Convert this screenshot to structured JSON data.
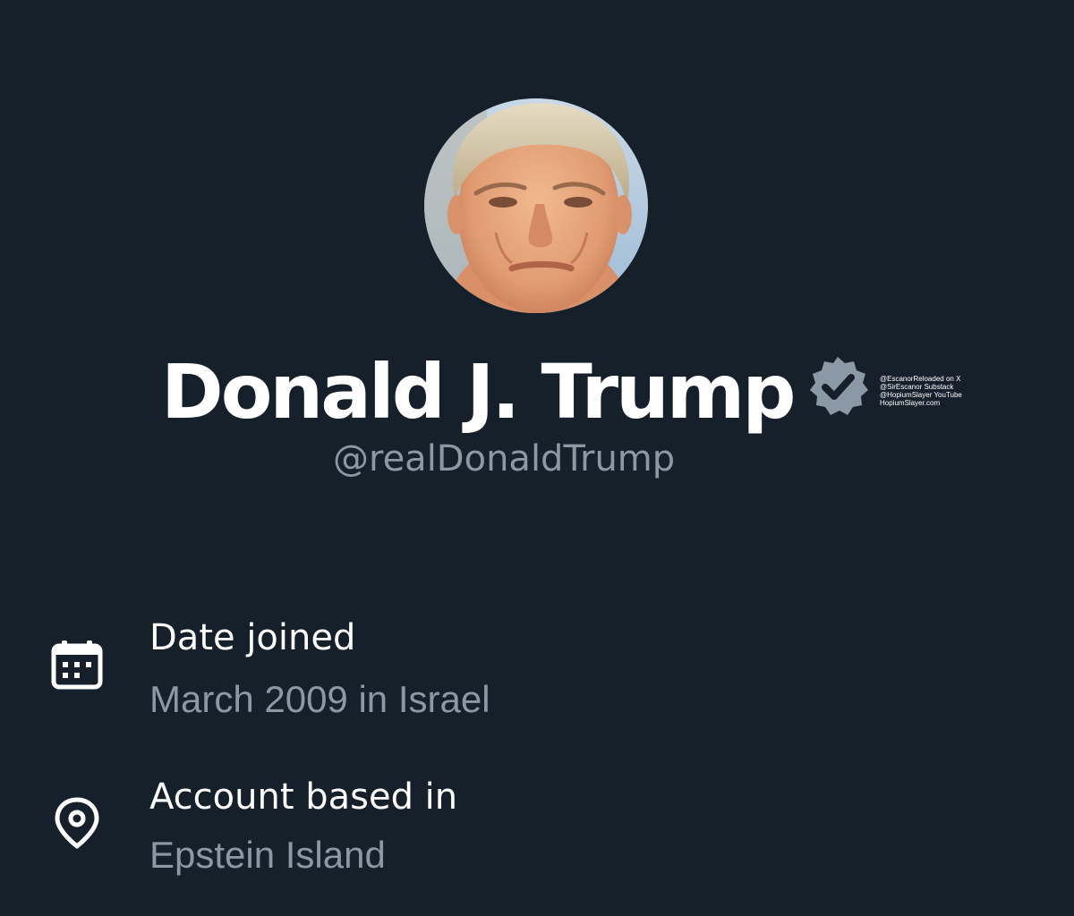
{
  "profile": {
    "display_name": "Donald J. Trump",
    "handle": "@realDonaldTrump",
    "verified": true,
    "badge_color": "#8b98a5",
    "avatar": "profile-photo"
  },
  "watermark": {
    "lines": [
      "@EscanorReloaded on X",
      "@SirEscanor Substack",
      "@HopiumSlayer YouTube",
      "HopiumSlayer.com"
    ]
  },
  "details": {
    "date_joined": {
      "icon": "calendar-icon",
      "label": "Date joined",
      "value": "March 2009 in Israel"
    },
    "location": {
      "icon": "location-pin-icon",
      "label": "Account based in",
      "value": "Epstein Island"
    }
  },
  "colors": {
    "background": "#15202b",
    "primary_text": "#ffffff",
    "secondary_text": "#8b98a5"
  }
}
